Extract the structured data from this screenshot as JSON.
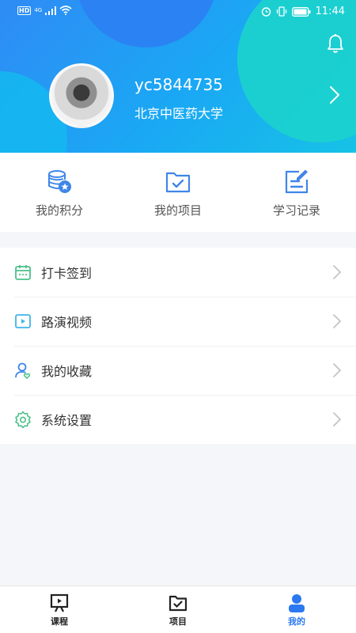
{
  "status_bar": {
    "hd": "HD",
    "network": "4G",
    "time": "11:44"
  },
  "profile": {
    "username": "yc5844735",
    "school": "北京中医药大学"
  },
  "quick_actions": [
    {
      "label": "我的积分",
      "icon": "coins-star-icon"
    },
    {
      "label": "我的项目",
      "icon": "folder-check-icon"
    },
    {
      "label": "学习记录",
      "icon": "edit-record-icon"
    }
  ],
  "menu": [
    {
      "label": "打卡签到",
      "icon": "calendar-icon"
    },
    {
      "label": "路演视频",
      "icon": "video-icon"
    },
    {
      "label": "我的收藏",
      "icon": "user-heart-icon"
    },
    {
      "label": "系统设置",
      "icon": "gear-icon"
    }
  ],
  "bottom_nav": [
    {
      "label": "课程",
      "icon": "presentation-icon",
      "active": false
    },
    {
      "label": "项目",
      "icon": "folder-check-icon",
      "active": false
    },
    {
      "label": "我的",
      "icon": "person-icon",
      "active": true
    }
  ],
  "colors": {
    "primary": "#2a79f0",
    "icon_blue": "#3f86e8",
    "icon_green": "#4cc08a",
    "header_teal": "#1bd1cf"
  }
}
